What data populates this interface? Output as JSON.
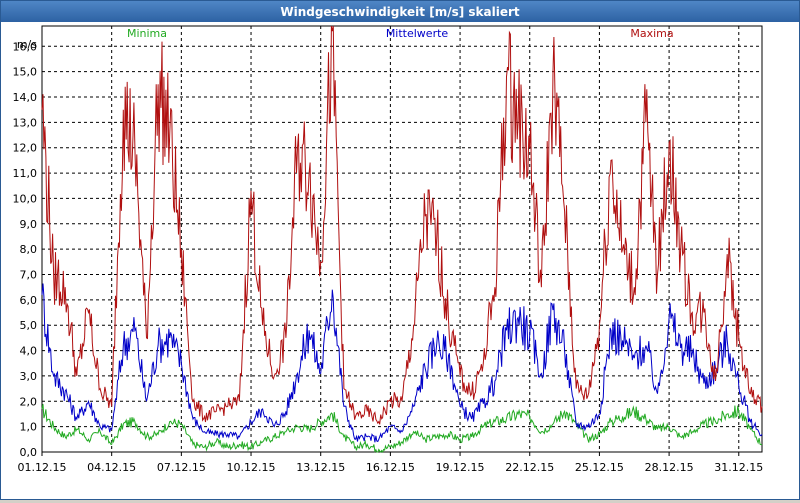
{
  "window": {
    "title": "Windgeschwindigkeit [m/s] skaliert"
  },
  "colors": {
    "minima": "#22aa22",
    "mittel": "#0000c8",
    "maxima": "#b01010",
    "grid": "#000000"
  },
  "chart_data": {
    "type": "line",
    "title": "Windgeschwindigkeit [m/s] skaliert",
    "ylabel": "m/s",
    "ylim": [
      0,
      16.8
    ],
    "xlim_days": [
      1,
      32
    ],
    "y_ticks": [
      "0,0",
      "1,0",
      "2,0",
      "3,0",
      "4,0",
      "5,0",
      "6,0",
      "7,0",
      "8,0",
      "9,0",
      "10,0",
      "11,0",
      "12,0",
      "13,0",
      "14,0",
      "15,0",
      "16,0"
    ],
    "x_ticks": [
      "01.12.15",
      "04.12.15",
      "07.12.15",
      "10.12.15",
      "13.12.15",
      "16.12.15",
      "19.12.15",
      "22.12.15",
      "25.12.15",
      "28.12.15",
      "31.12.15"
    ],
    "grid": true,
    "series": [
      {
        "name": "Minima",
        "color": "#22aa22",
        "days": [
          1,
          1.5,
          2,
          2.5,
          3,
          3.5,
          4,
          4.5,
          5,
          5.5,
          6,
          6.5,
          7,
          7.5,
          8,
          8.5,
          9,
          9.5,
          10,
          10.5,
          11,
          11.5,
          12,
          12.5,
          13,
          13.5,
          14,
          14.5,
          15,
          15.5,
          16,
          16.5,
          17,
          17.5,
          18,
          18.5,
          19,
          19.5,
          20,
          20.5,
          21,
          21.5,
          22,
          22.5,
          23,
          23.5,
          24,
          24.5,
          25,
          25.5,
          26,
          26.5,
          27,
          27.5,
          28,
          28.5,
          29,
          29.5,
          30,
          30.5,
          31,
          31.5,
          32
        ],
        "values": [
          1.7,
          1.0,
          0.6,
          0.9,
          0.5,
          0.8,
          0.3,
          1.1,
          1.2,
          0.6,
          0.7,
          1.2,
          1.1,
          0.3,
          0.2,
          0.4,
          0.2,
          0.3,
          0.2,
          0.4,
          0.6,
          0.8,
          1.0,
          0.9,
          1.2,
          1.5,
          0.6,
          0.2,
          0.3,
          0.1,
          0.2,
          0.4,
          0.8,
          0.5,
          0.6,
          0.7,
          0.5,
          0.6,
          1.0,
          1.2,
          1.3,
          1.5,
          1.4,
          0.8,
          1.1,
          1.6,
          1.1,
          0.5,
          0.7,
          1.2,
          1.4,
          1.6,
          1.3,
          0.9,
          1.0,
          0.6,
          0.8,
          1.1,
          1.2,
          1.5,
          1.6,
          0.9,
          0.3
        ]
      },
      {
        "name": "Mittelwerte",
        "color": "#0000c8",
        "days": [
          1,
          1.5,
          2,
          2.5,
          3,
          3.5,
          4,
          4.5,
          5,
          5.5,
          6,
          6.5,
          7,
          7.5,
          8,
          8.5,
          9,
          9.5,
          10,
          10.5,
          11,
          11.5,
          12,
          12.5,
          13,
          13.5,
          14,
          14.5,
          15,
          15.5,
          16,
          16.5,
          17,
          17.5,
          18,
          18.5,
          19,
          19.5,
          20,
          20.5,
          21,
          21.5,
          22,
          22.5,
          23,
          23.5,
          24,
          24.5,
          25,
          25.5,
          26,
          26.5,
          27,
          27.5,
          28,
          28.5,
          29,
          29.5,
          30,
          30.5,
          31,
          31.5,
          32
        ],
        "values": [
          6.2,
          3.0,
          2.4,
          1.3,
          2.0,
          1.0,
          0.9,
          4.2,
          4.8,
          2.0,
          4.2,
          4.5,
          3.5,
          1.3,
          0.8,
          0.7,
          0.7,
          0.6,
          1.2,
          1.7,
          1.0,
          1.6,
          3.1,
          4.8,
          3.1,
          6.4,
          1.8,
          0.5,
          0.6,
          0.5,
          1.0,
          0.8,
          1.8,
          3.3,
          4.3,
          3.8,
          1.8,
          1.3,
          1.9,
          2.8,
          4.8,
          5.3,
          4.6,
          3.1,
          5.6,
          4.0,
          1.1,
          1.0,
          1.5,
          4.8,
          4.4,
          3.7,
          4.2,
          2.3,
          5.3,
          4.1,
          3.9,
          2.7,
          3.3,
          4.4,
          2.6,
          1.2,
          0.7
        ]
      },
      {
        "name": "Maxima",
        "color": "#b01010",
        "days": [
          1,
          1.5,
          2,
          2.5,
          3,
          3.5,
          4,
          4.5,
          5,
          5.5,
          6,
          6.5,
          7,
          7.5,
          8,
          8.5,
          9,
          9.5,
          10,
          10.5,
          11,
          11.5,
          12,
          12.5,
          13,
          13.5,
          14,
          14.5,
          15,
          15.5,
          16,
          16.5,
          17,
          17.5,
          18,
          18.5,
          19,
          19.5,
          20,
          20.5,
          21,
          21.5,
          22,
          22.5,
          23,
          23.5,
          24,
          24.5,
          25,
          25.5,
          26,
          26.5,
          27,
          27.5,
          28,
          28.5,
          29,
          29.5,
          30,
          30.5,
          31,
          31.5,
          32
        ],
        "values": [
          13.5,
          7.0,
          6.5,
          3.0,
          5.5,
          2.5,
          1.8,
          13.5,
          12.0,
          4.5,
          14.5,
          12.5,
          8.0,
          2.0,
          1.4,
          1.6,
          1.8,
          2.0,
          10.3,
          5.0,
          3.0,
          4.5,
          12.0,
          11.0,
          7.5,
          16.6,
          2.5,
          1.4,
          1.6,
          1.2,
          2.0,
          2.0,
          5.0,
          9.3,
          8.5,
          5.2,
          3.0,
          2.3,
          3.5,
          6.5,
          14.8,
          13.0,
          12.0,
          6.5,
          15.0,
          9.5,
          2.5,
          2.2,
          5.0,
          11.5,
          8.0,
          6.5,
          13.0,
          7.0,
          12.2,
          8.0,
          5.5,
          5.5,
          2.8,
          7.8,
          4.5,
          2.3,
          1.8
        ]
      }
    ]
  }
}
